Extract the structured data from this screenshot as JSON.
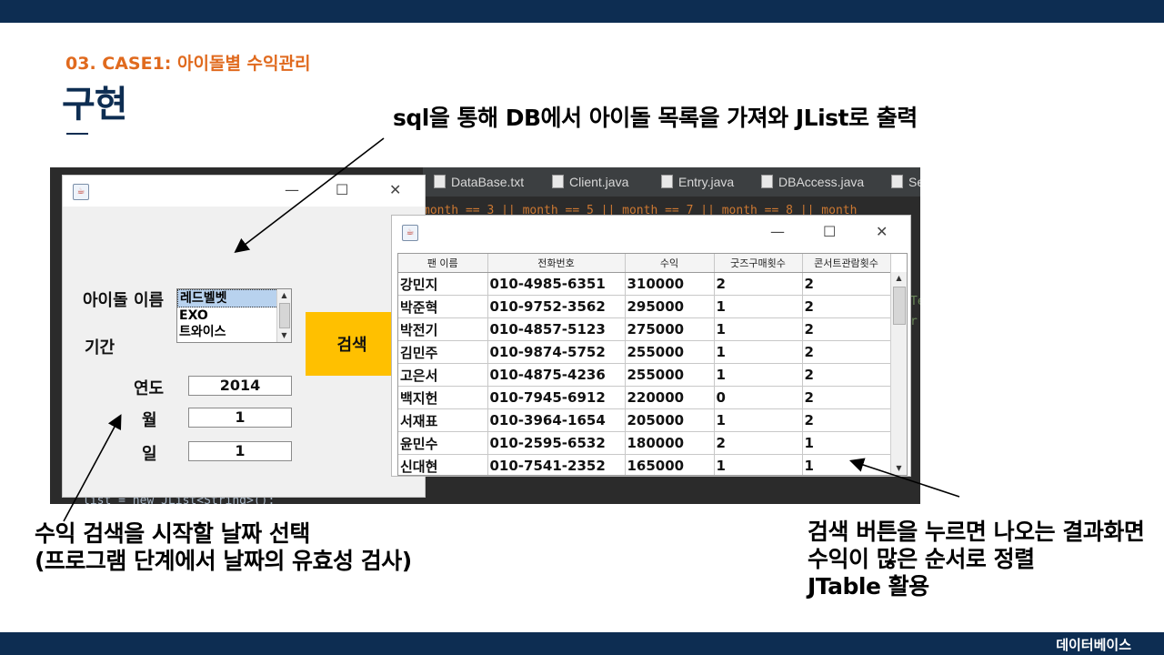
{
  "slide": {
    "subtitle": "03. CASE1: 아이돌별 수익관리",
    "title": "구현",
    "footer": "데이터베이스"
  },
  "annotations": {
    "top": "sql을 통해 DB에서 아이돌 목록을 가져와 JList로 출력",
    "left_line1": "수익 검색을 시작할 날짜 선택",
    "left_line2": "(프로그램 단계에서 날짜의 유효성 검사)",
    "right_line1": "검색 버튼을 누르면 나오는 결과화면",
    "right_line2": "수익이 많은 순서로 정렬",
    "right_line3": "JTable 활용"
  },
  "ide": {
    "tabs": [
      "DataBase.txt",
      "Client.java",
      "Entry.java",
      "DBAccess.java",
      "Se"
    ],
    "code_top": "month == 3 || month == 5 || month == 7 || month == 8 || month",
    "code_bottom": "list = new JList<String>();",
    "side_1": "Te",
    "side_2": "r"
  },
  "left_window": {
    "controls": {
      "minimize": "—",
      "maximize": "☐",
      "close": "✕"
    },
    "idol_label": "아이돌 이름",
    "idol_list": [
      "레드벨벳",
      "EXO",
      "트와이스"
    ],
    "selected_idol": "레드벨벳",
    "period_label": "기간",
    "year_label": "연도",
    "month_label": "월",
    "day_label": "일",
    "year_value": "2014",
    "month_value": "1",
    "day_value": "1",
    "search_button": "검색"
  },
  "right_window": {
    "controls": {
      "minimize": "—",
      "maximize": "☐",
      "close": "✕"
    },
    "columns": [
      "팬 이름",
      "전화번호",
      "수익",
      "굿즈구매횟수",
      "콘서트관람횟수"
    ],
    "rows": [
      [
        "강민지",
        "010-4985-6351",
        "310000",
        "2",
        "2"
      ],
      [
        "박준혁",
        "010-9752-3562",
        "295000",
        "1",
        "2"
      ],
      [
        "박전기",
        "010-4857-5123",
        "275000",
        "1",
        "2"
      ],
      [
        "김민주",
        "010-9874-5752",
        "255000",
        "1",
        "2"
      ],
      [
        "고은서",
        "010-4875-4236",
        "255000",
        "1",
        "2"
      ],
      [
        "백지헌",
        "010-7945-6912",
        "220000",
        "0",
        "2"
      ],
      [
        "서재표",
        "010-3964-1654",
        "205000",
        "1",
        "2"
      ],
      [
        "윤민수",
        "010-2595-6532",
        "180000",
        "2",
        "1"
      ],
      [
        "신대현",
        "010-7541-2352",
        "165000",
        "1",
        "1"
      ]
    ]
  },
  "icons": {
    "java": "java-cup-icon",
    "file": "file-icon",
    "scroll_up": "▲",
    "scroll_down": "▼"
  },
  "colors": {
    "navy": "#0d2d52",
    "orange": "#e06a1e",
    "button": "#ffc000",
    "selection": "#b8d2ee"
  }
}
